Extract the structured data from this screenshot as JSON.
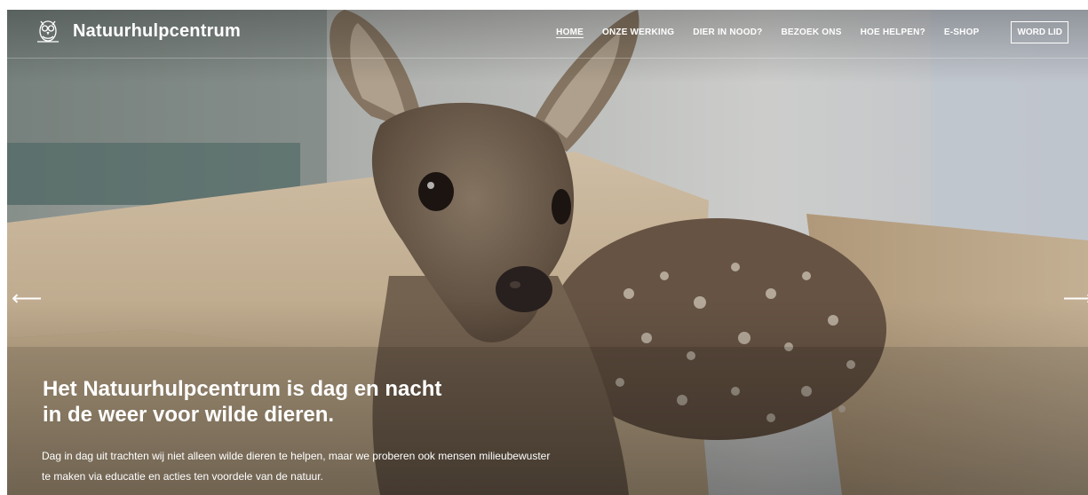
{
  "brand": {
    "name": "Natuurhulpcentrum",
    "logo_icon": "owl-logo-icon"
  },
  "nav": {
    "items": [
      {
        "label": "HOME",
        "active": true
      },
      {
        "label": "ONZE WERKING",
        "active": false
      },
      {
        "label": "DIER IN NOOD?",
        "active": false
      },
      {
        "label": "BEZOEK ONS",
        "active": false
      },
      {
        "label": "HOE HELPEN?",
        "active": false
      },
      {
        "label": "E-SHOP",
        "active": false
      }
    ],
    "cta": "WORD LID"
  },
  "slider": {
    "prev_icon": "arrow-left-icon",
    "next_icon": "arrow-right-icon"
  },
  "hero": {
    "image": "photo of a roe deer fawn in a cardboard box",
    "title_line1": "Het Natuurhulpcentrum is dag en nacht",
    "title_line2": "in de weer voor wilde dieren.",
    "text_line1": "Dag in dag uit trachten wij niet alleen wilde dieren te helpen, maar we proberen ook mensen milieubewuster",
    "text_line2": "te maken via educatie en acties ten voordele van de natuur."
  },
  "colors": {
    "text": "#ffffff",
    "overlay": "#000000"
  }
}
